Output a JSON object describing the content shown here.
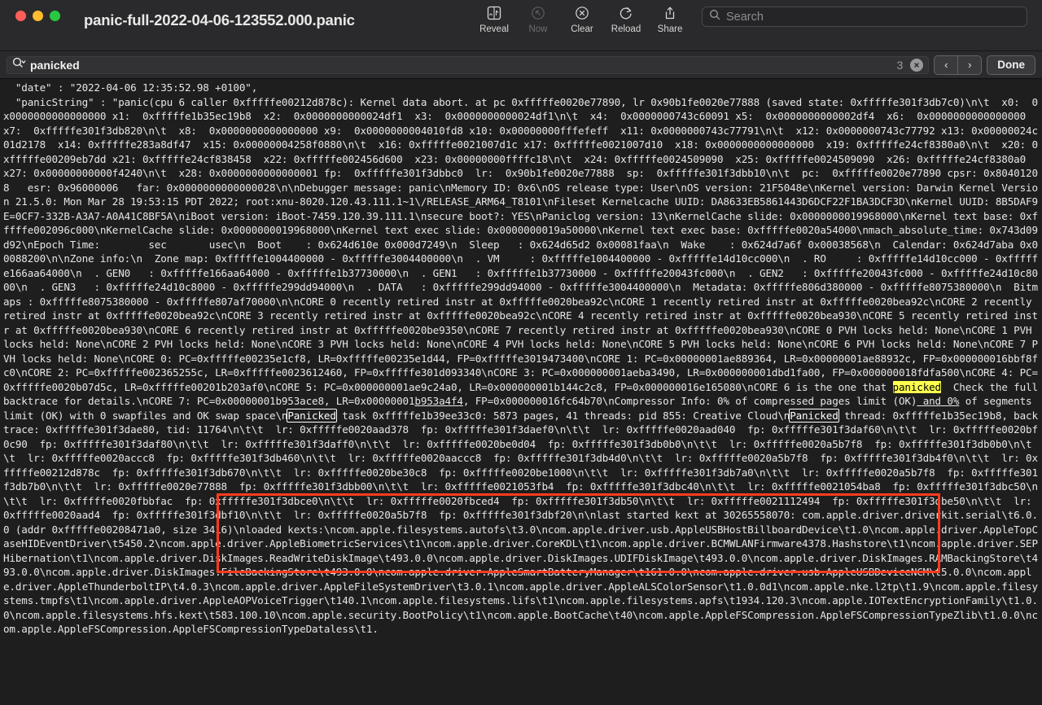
{
  "window": {
    "title": "panic-full-2022-04-06-123552.000.panic",
    "traffic_lights": [
      {
        "name": "close",
        "color": "#ff5f57"
      },
      {
        "name": "minimize",
        "color": "#febc2e"
      },
      {
        "name": "maximize",
        "color": "#28c840"
      }
    ]
  },
  "toolbar": {
    "items": [
      {
        "label": "Reveal",
        "icon": "finder-reveal-icon",
        "disabled": false
      },
      {
        "label": "Now",
        "icon": "now-arrow-icon",
        "disabled": true
      },
      {
        "label": "Clear",
        "icon": "clear-circle-x-icon",
        "disabled": false
      },
      {
        "label": "Reload",
        "icon": "reload-circular-arrow-icon",
        "disabled": false
      },
      {
        "label": "Share",
        "icon": "share-upload-icon",
        "disabled": false
      }
    ]
  },
  "search": {
    "placeholder": "Search",
    "icon": "search-magnifier-icon"
  },
  "findbar": {
    "query": "panicked",
    "match_count": "3",
    "prev_label": "‹",
    "next_label": "›",
    "done_label": "Done",
    "clear_label": "✕",
    "search_icon": "search-magnifier-dropdown-icon"
  },
  "annotation": {
    "color": "#ff3b1f",
    "shape": "rectangle"
  },
  "highlight": {
    "current_color": "#ffff4d",
    "other_outline_color": "#ffffff"
  },
  "log": {
    "segments": [
      {
        "t": "  \"date\" : \"2022-04-06 12:35:52.98 +0100\",\n  \"panicString\" : \"panic(cpu 6 caller 0xfffffe00212d878c): Kernel data abort. at pc 0xfffffe0020e77890, lr 0x90b1fe0020e77888 (saved state: 0xfffffe301f3db7c0)\\n\\t  x0:  0x0000000000000000 x1:  0xfffffe1b35ec19b8  x2:  0x0000000000024df1  x3:  0x0000000000024df1\\n\\t  x4:  0x0000000743c60091 x5:  0x0000000000002df4  x6:  0x0000000000000000  x7:  0xfffffe301f3db820\\n\\t  x8:  0x0000000000000000 x9:  0x0000000004010fd8 x10: 0x00000000fffefeff  x11: 0x0000000743c77791\\n\\t  x12: 0x0000000743c77792 x13: 0x00000024c01d2178  x14: 0xfffffe283a8df47  x15: 0x00000004258f0880\\n\\t  x16: 0xfffffe0021007d1c x17: 0xfffffe0021007d10  x18: 0x0000000000000000  x19: 0xfffffe24cf8380a0\\n\\t  x20: 0xfffffe00209eb7dd x21: 0xfffffe24cf838458  x22: 0xfffffe002456d600  x23: 0x00000000ffffc18\\n\\t  x24: 0xfffffe0024509090  x25: 0xfffffe0024509090  x26: 0xfffffe24cf8380a0  x27: 0x00000000000f4240\\n\\t  x28: 0x0000000000000001 fp:  0xfffffe301f3dbbc0  lr:  0x90b1fe0020e77888  sp:  0xfffffe301f3dbb10\\n\\t  pc:  0xfffffe0020e77890 cpsr: 0x80401208   esr: 0x96000006   far: 0x0000000000000028\\n\\nDebugger message: panic\\nMemory ID: 0x6\\nOS release type: User\\nOS version: 21F5048e\\nKernel version: Darwin Kernel Version 21.5.0: Mon Mar 28 19:53:15 PDT 2022; root:xnu-8020.120.43.111.1~1\\/RELEASE_ARM64_T8101\\nFileset Kernelcache UUID: DA8633EB5861443D6DCF22F1BA3DCF3D\\nKernel UUID: 8B5DAF9E=0CF7-332B-A3A7-A0A41C8BF5A\\niBoot version: iBoot-7459.120.39.111.1\\nsecure boot?: YES\\nPaniclog version: 13\\nKernelCache slide: 0x0000000019968000\\nKernel text base: 0xfffffe002096c000\\nKernelCache slide: 0x0000000019968000\\nKernel text exec slide: 0x0000000019a50000\\nKernel text exec base: 0xfffffe0020a54000\\nmach_absolute_time: 0x743d09d92\\nEpoch Time:        sec       usec\\n  Boot    : 0x624d610e 0x000d7249\\n  Sleep   : 0x624d65d2 0x00081faa\\n  Wake    : 0x624d7a6f 0x00038568\\n  Calendar: 0x624d7aba 0x00088200\\n\\nZone info:\\n  Zone map: 0xfffffe1004400000 - 0xfffffe3004400000\\n  . VM     : 0xfffffe1004400000 - 0xfffffe14d10cc000\\n  . RO     : 0xfffffe14d10cc000 - 0xfffffe166aa64000\\n  . GEN0   : 0xfffffe166aa64000 - 0xfffffe1b37730000\\n  . GEN1   : 0xfffffe1b37730000 - 0xfffffe20043fc000\\n  . GEN2   : 0xfffffe20043fc000 - 0xfffffe24d10c8000\\n  . GEN3   : 0xfffffe24d10c8000 - 0xfffffe299dd94000\\n  . DATA   : 0xfffffe299dd94000 - 0xfffffe3004400000\\n  Metadata: 0xfffffe806d380000 - 0xfffffe8075380000\\n  Bitmaps : 0xfffffe8075380000 - 0xfffffe807af70000\\n\\nCORE 0 recently retired instr at 0xfffffe0020bea92c\\nCORE 1 recently retired instr at 0xfffffe0020bea92c\\nCORE 2 recently retired instr at 0xfffffe0020bea92c\\nCORE 3 recently retired instr at 0xfffffe0020bea92c\\nCORE 4 recently retired instr at 0xfffffe0020bea930\\nCORE 5 recently retired instr at 0xfffffe0020bea930\\nCORE 6 recently retired instr at 0xfffffe0020be9350\\nCORE 7 recently retired instr at 0xfffffe0020bea930\\nCORE 0 PVH locks held: None\\nCORE 1 PVH locks held: None\\nCORE 2 PVH locks held: None\\nCORE 3 PVH locks held: None\\nCORE 4 PVH locks held: None\\nCORE 5 PVH locks held: None\\nCORE 6 PVH locks held: None\\nCORE 7 PVH locks held: None\\nCORE 0: PC=0xfffffe00235e1cf8, LR=0xfffffe00235e1d44, FP=0xfffffe3019473400\\nCORE 1: PC=0x00000001ae889364, LR=0x00000001ae88932c, FP=0x000000016bbf8fc0\\nCORE 2: PC=0xfffffe002365255c, LR=0xfffffe0023612460, FP=0xfffffe301d093340\\nCORE 3: PC=0x000000001aeba3490, LR=0x000000001dbd1fa00, FP=0x000000018fdfa500\\nCORE 4: PC=0xfffffe0020b07d5c, LR=0xfffffe0020"
      },
      {
        "t": "1b203af0",
        "cls": ""
      },
      {
        "t": "\\nCORE 5: PC=0x000000001ae9c24a0, LR=0x000000001b144c2c8, FP=0x000000016e165080\\nCORE 6 is the one that "
      },
      {
        "t": "panicked",
        "cls": "hl-current"
      },
      {
        "t": "  Check the full backtrace for details.\\nCORE 7: PC=0x00000001b953ace8, LR=0x00000001"
      },
      {
        "t": "b953a4f4",
        "cls": "underlined"
      },
      {
        "t": ", FP=0x000000016fc64b70\\nCompressor Info: 0% of compressed pages limit (OK)"
      },
      {
        "t": " and 0%",
        "cls": "underlined"
      },
      {
        "t": " of segments limit (OK) with 0 swapfiles and OK swap space\\n"
      },
      {
        "t": "Panicked",
        "cls": "hl-other"
      },
      {
        "t": " task 0xfffffe1b39ee33c0: 5873 pages, 41 threads: pid 855: Creative Cloud\\n"
      },
      {
        "t": "Panicked",
        "cls": "hl-other"
      },
      {
        "t": " thread: 0xfffffe1b35ec19b8, backtrace: 0xfffffe301f3dae80, tid: 11764\\n\\t\\t  lr: 0xfffffe0020aad378  fp: 0xfffffe301f3daef0\\n\\t\\t  lr: 0xfffffe0020aad040  fp: 0xfffffe301f3daf60\\n\\t\\t  lr: 0xfffffe0020bf0c90  fp: 0xfffffe301f3daf80\\n\\t\\t  lr: 0xfffffe301f3daff0\\n\\t\\t  lr: 0xfffffe0020be0d04  fp: 0xfffffe301f3db0b0\\n\\t\\t  lr: 0xfffffe0020a5b7f8  fp: 0xfffffe301f3db0b0\\n\\t\\t  lr: 0xfffffe0020accc8  fp: 0xfffffe301f3db460\\n\\t\\t  lr: 0xfffffe0020aaccc8  fp: 0xfffffe301f3db4d0\\n\\t\\t  lr: 0xfffffe0020a5b7f8  fp: 0xfffffe301f3db4f0\\n\\t\\t  lr: 0xfffffe00212d878c  fp: 0xfffffe301f3db670\\n\\t\\t  lr: 0xfffffe0020be30c8  fp: 0xfffffe0020be1000\\n\\t\\t  lr: 0xfffffe301f3db7a0\\n\\t\\t  lr: 0xfffffe0020a5b7f8  fp: 0xfffffe301f3db7b0\\n\\t\\t  lr: 0xfffffe0020e77888  fp: 0xfffffe301f3dbb00\\n\\t\\t  lr: 0xfffffe0021053fb4  fp: 0xfffffe301f3dbc40\\n\\t\\t  lr: 0xfffffe0021054ba8  fp: 0xfffffe301f3dbc50\\n\\t\\t  lr: 0xfffffe0020fbbfac  fp: 0xfffffe301f3dbce0\\n\\t\\t  lr: 0xfffffe0020fbced4  fp: 0xfffffe301f3db50\\n\\t\\t  lr: 0xfffffe0021112494  fp: 0xfffffe301f3dbe50\\n\\t\\t  lr: 0xfffffe0020aad4  fp: 0xfffffe301f3dbf10\\n\\t\\t  lr: 0xfffffe0020a5b7f8  fp: 0xfffffe301f3dbf20\\n\\nlast started kext at 30265558070: com.apple.driver.driverkit.serial\\t6.0.0 (addr 0xfffffe00208471a0, size 3416)\\nloaded kexts:\\ncom.apple.filesystems.autofs\\t3.0\\ncom.apple.driver.usb.AppleUSBHostBillboardDevice\\t1.0\\ncom.apple.driver.AppleTopCaseHIDEventDriver\\t5450.2\\ncom.apple.driver.AppleBiometricServices\\t1\\ncom.apple.driver.CoreKDL\\t1\\ncom.apple.driver.BCMWLANFirmware4378.Hashstore\\t1\\ncom.apple.driver.SEPHibernation\\t1\\ncom.apple.driver.DiskImages.ReadWriteDiskImage\\t493.0.0\\ncom.apple.driver.DiskImages.UDIFDiskImage\\t493.0.0\\ncom.apple.driver.DiskImages.RAMBackingStore\\t493.0.0\\ncom.apple.driver.DiskImages.FileBackingStore\\t493.0.0\\ncom.apple.driver.AppleSmartBatteryManager\\t161.0.0\\ncom.apple.driver.usb.AppleUSBDeviceNCM\\t5.0.0\\ncom.apple.driver.AppleThunderboltIP\\t4.0.3\\ncom.apple.driver.AppleFileSystemDriver\\t3.0.1\\ncom.apple.driver.AppleALSColorSensor\\t1.0.0d1\\ncom.apple.nke.l2tp\\t1.9\\ncom.apple.filesystems.tmpfs\\t1\\ncom.apple.driver.AppleAOPVoiceTrigger\\t140.1\\ncom.apple.filesystems.lifs\\t1\\ncom.apple.filesystems.apfs\\t1934.120.3\\ncom.apple.IOTextEncryptionFamily\\t1.0.0\\ncom.apple.filesystems.hfs.kext\\t583.100.10\\ncom.apple.security.BootPolicy\\t1\\ncom.apple.BootCache\\t40\\ncom.apple.AppleFSCompression.AppleFSCompressionTypeZlib\\t1.0.0\\ncom.apple.AppleFSCompression.AppleFSCompressionTypeDataless\\t1."
      }
    ]
  }
}
